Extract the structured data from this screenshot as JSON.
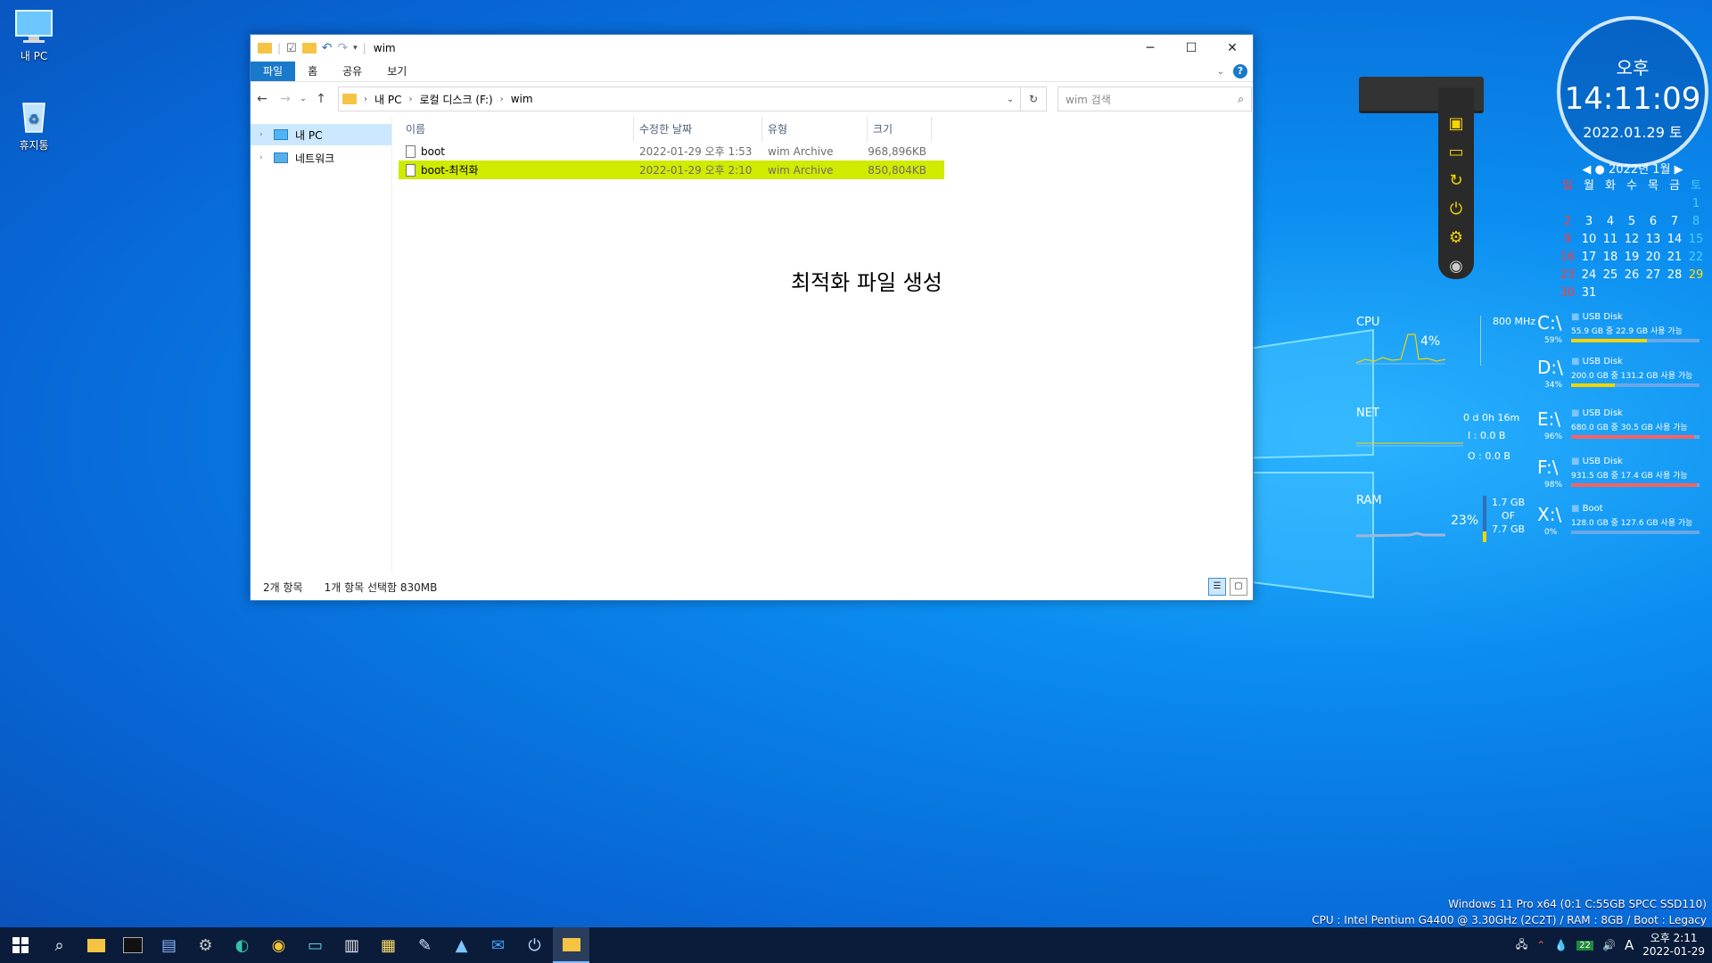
{
  "desktop": {
    "icons": [
      {
        "label": "내 PC"
      },
      {
        "label": "휴지통"
      }
    ]
  },
  "explorer": {
    "title": "wim",
    "ribbon_tabs": [
      "파일",
      "홈",
      "공유",
      "보기"
    ],
    "help_glyph": "?",
    "breadcrumb": [
      "내 PC",
      "로컬 디스크 (F:)",
      "wim"
    ],
    "search_placeholder": "wim 검색",
    "nav_items": [
      {
        "label": "내 PC",
        "selected": true
      },
      {
        "label": "네트워크",
        "selected": false
      }
    ],
    "columns": [
      "이름",
      "수정한 날짜",
      "유형",
      "크기"
    ],
    "files": [
      {
        "name": "boot",
        "modified": "2022-01-29 오후 1:53",
        "type": "wim Archive",
        "size": "968,896KB",
        "selected": false
      },
      {
        "name": "boot-최적화",
        "modified": "2022-01-29 오후 2:10",
        "type": "wim Archive",
        "size": "850,804KB",
        "selected": true
      }
    ],
    "annotation": "최적화 파일 생성",
    "status": {
      "count": "2개 항목",
      "selection": "1개 항목 선택함 830MB"
    }
  },
  "clock": {
    "ampm": "오후",
    "time": "14:11:09",
    "date": "2022.01.29 토"
  },
  "calendar": {
    "header": "2022년 1월",
    "weekdays": [
      "일",
      "월",
      "화",
      "수",
      "목",
      "금",
      "토"
    ],
    "days": [
      "",
      "",
      "",
      "",
      "",
      "",
      "1",
      "2",
      "3",
      "4",
      "5",
      "6",
      "7",
      "8",
      "9",
      "10",
      "11",
      "12",
      "13",
      "14",
      "15",
      "16",
      "17",
      "18",
      "19",
      "20",
      "21",
      "22",
      "23",
      "24",
      "25",
      "26",
      "27",
      "28",
      "29",
      "30",
      "31",
      "",
      "",
      "",
      "",
      ""
    ],
    "today": "29"
  },
  "monitor": {
    "cpu": {
      "label": "CPU",
      "freq": "800 MHz",
      "percent": "4%"
    },
    "net": {
      "label": "NET",
      "uptime": "0 d 0h 16m",
      "in": "I : 0.0 B",
      "out": "O : 0.0 B"
    },
    "ram": {
      "label": "RAM",
      "percent": "23%",
      "used": "1.7 GB",
      "of": "OF",
      "total": "7.7 GB"
    }
  },
  "drives": [
    {
      "letter": "C:\\",
      "pct": "59%",
      "name": "USB Disk",
      "detail": "55.9 GB 중  22.9 GB 사용 가능",
      "fill": 0.59,
      "color": "#f5d400"
    },
    {
      "letter": "D:\\",
      "pct": "34%",
      "name": "USB Disk",
      "detail": "200.0 GB 중 131.2 GB 사용 가능",
      "fill": 0.34,
      "color": "#f5d400"
    },
    {
      "letter": "E:\\",
      "pct": "96%",
      "name": "USB Disk",
      "detail": "680.0 GB 중 30.5 GB 사용 가능",
      "fill": 0.96,
      "color": "#ff6060"
    },
    {
      "letter": "F:\\",
      "pct": "98%",
      "name": "USB Disk",
      "detail": "931.5 GB 중 17.4 GB 사용 가능",
      "fill": 0.98,
      "color": "#ff6060"
    },
    {
      "letter": "X:\\",
      "pct": "0%",
      "name": "Boot",
      "detail": "128.0 GB 중 127.6 GB 사용 가능",
      "fill": 0.0,
      "color": "#f5d400"
    }
  ],
  "sysinfo": {
    "line1": "Windows 11 Pro x64 (0:1 C:55GB SPCC SSD110)",
    "line2": "CPU : Intel Pentium G4400 @ 3.30GHz (2C2T) / RAM : 8GB / Boot : Legacy"
  },
  "taskbar": {
    "apps": [
      "start-icon",
      "search-icon",
      "file-explorer-icon",
      "terminal-icon",
      "floppy-icon",
      "settings-icon",
      "edge-icon",
      "chrome-icon",
      "monitor-icon",
      "archive-icon",
      "notepad-icon",
      "pencil-icon",
      "photos-icon",
      "mail-icon",
      "power-icon",
      "folder-icon"
    ],
    "tray_badge": "22",
    "ime": "A",
    "time": "오후 2:11",
    "date": "2022-01-29"
  }
}
